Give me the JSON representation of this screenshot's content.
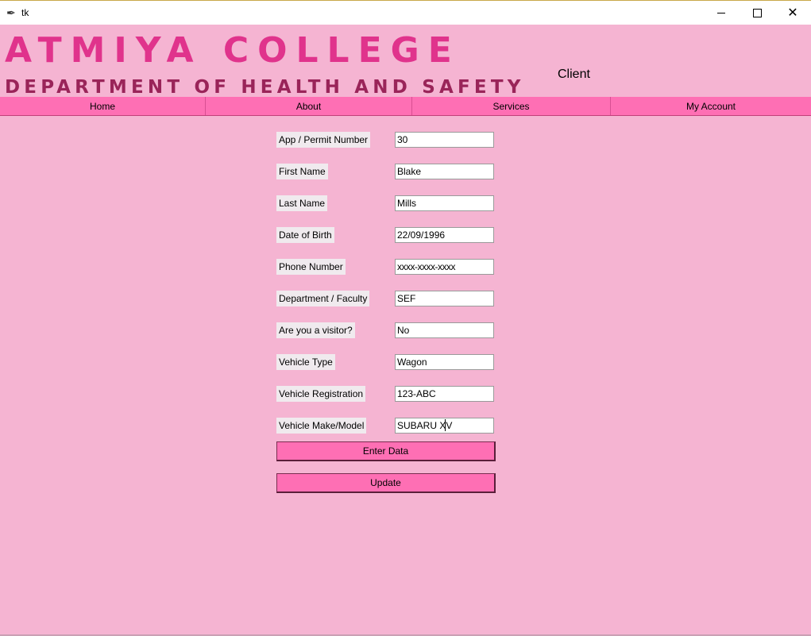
{
  "window": {
    "title": "tk"
  },
  "header": {
    "college": "ATMIYA COLLEGE",
    "department": "DEPARTMENT OF HEALTH AND SAFETY",
    "role": "Client"
  },
  "nav": {
    "items": [
      {
        "label": "Home"
      },
      {
        "label": "About"
      },
      {
        "label": "Services"
      },
      {
        "label": "My Account"
      }
    ]
  },
  "form": {
    "fields": [
      {
        "label": "App / Permit Number",
        "value": "30"
      },
      {
        "label": "First Name",
        "value": "Blake"
      },
      {
        "label": "Last Name",
        "value": "Mills"
      },
      {
        "label": "Date of Birth",
        "value": "22/09/1996"
      },
      {
        "label": "Phone Number",
        "value": "xxxx-xxxx-xxxx"
      },
      {
        "label": "Department / Faculty",
        "value": "SEF"
      },
      {
        "label": "Are you a visitor?",
        "value": "No"
      },
      {
        "label": "Vehicle Type",
        "value": "Wagon"
      },
      {
        "label": "Vehicle Registration",
        "value": "123-ABC"
      },
      {
        "label": "Vehicle Make/Model",
        "value": "SUBARU XV"
      }
    ],
    "enter_label": "Enter Data",
    "update_label": "Update"
  },
  "colors": {
    "background": "#f5b4d2",
    "nav": "#fe6fb4",
    "college_title": "#e0338c",
    "department_title": "#9a2459"
  }
}
